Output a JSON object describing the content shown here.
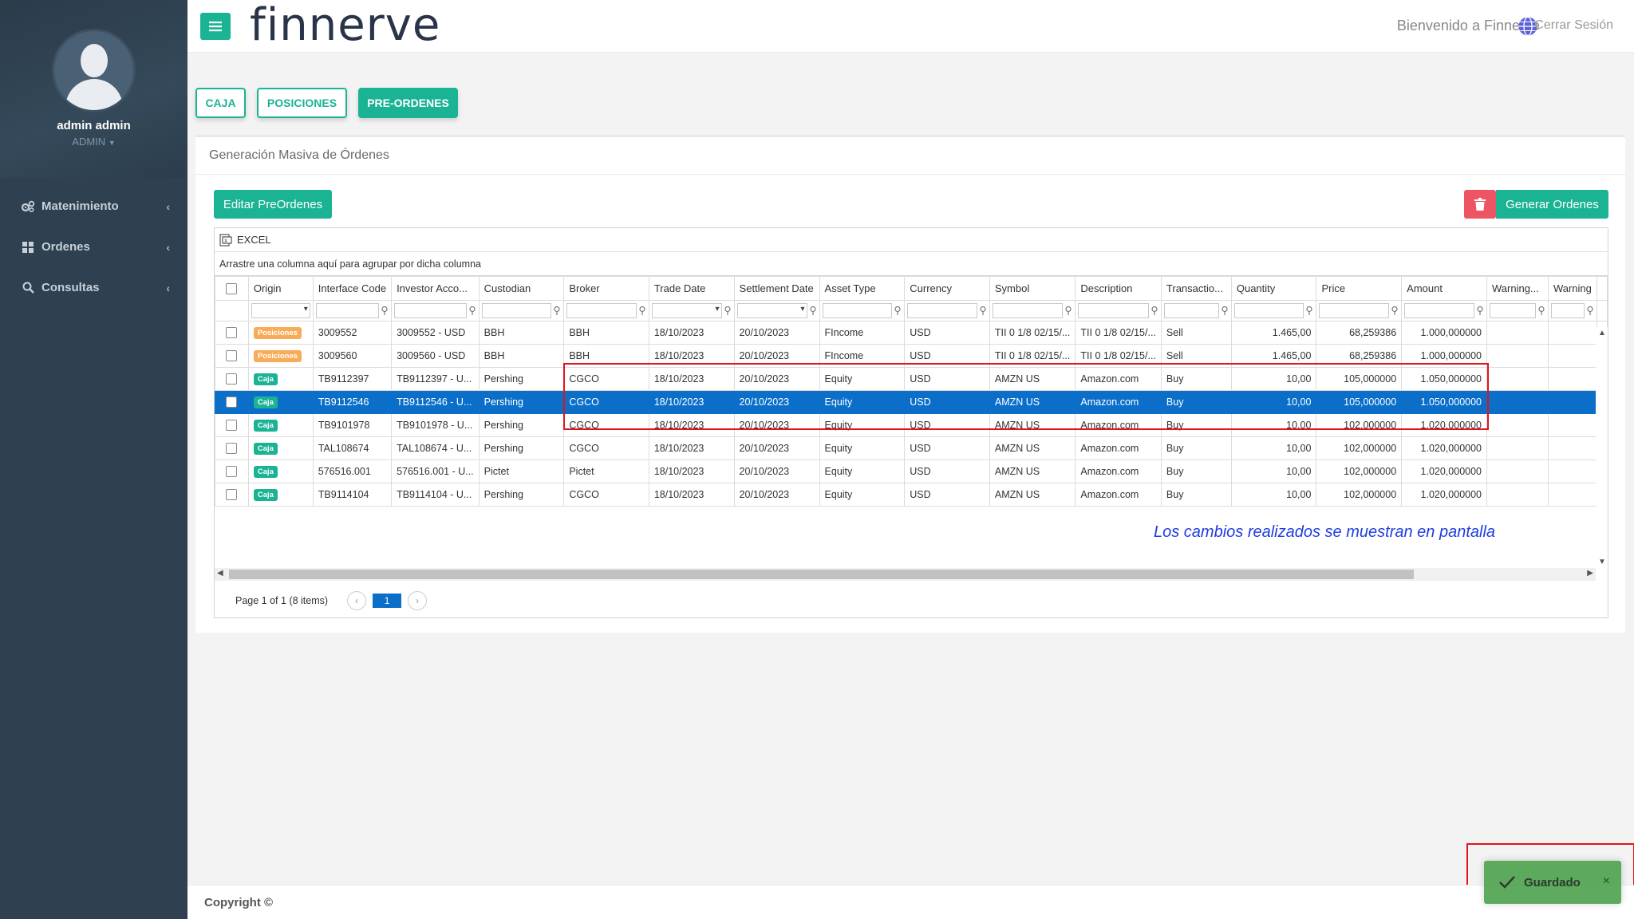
{
  "user": {
    "name": "admin admin",
    "role": "ADMIN"
  },
  "sidebar": {
    "items": [
      {
        "label": "Matenimiento",
        "icon": "gears-icon"
      },
      {
        "label": "Ordenes",
        "icon": "grid-icon"
      },
      {
        "label": "Consultas",
        "icon": "search-icon"
      }
    ]
  },
  "header": {
    "logo": "finnerve",
    "welcome": "Bienvenido a Finnerve",
    "logout": "Cerrar Sesión"
  },
  "tabs": [
    "CAJA",
    "POSICIONES",
    "PRE-ORDENES"
  ],
  "active_tab": "PRE-ORDENES",
  "panel": {
    "title": "Generación Masiva de Órdenes",
    "edit_button": "Editar PreOrdenes",
    "generate_button": "Generar Ordenes"
  },
  "grid": {
    "export_label": "EXCEL",
    "group_hint": "Arrastre una columna aquí para agrupar por dicha columna",
    "columns": [
      "Origin",
      "Interface Code",
      "Investor Acco...",
      "Custodian",
      "Broker",
      "Trade Date",
      "Settlement Date",
      "Asset Type",
      "Currency",
      "Symbol",
      "Description",
      "Transactio...",
      "Quantity",
      "Price",
      "Amount",
      "Warning...",
      "Warning"
    ],
    "rows": [
      {
        "origin": "Posiciones",
        "interface_code": "3009552",
        "investor_account": "3009552 - USD",
        "custodian": "BBH",
        "broker": "BBH",
        "trade_date": "18/10/2023",
        "settlement_date": "20/10/2023",
        "asset_type": "FIncome",
        "currency": "USD",
        "symbol": "TII 0 1/8 02/15/...",
        "description": "TII 0 1/8 02/15/...",
        "transaction": "Sell",
        "quantity": "1.465,00",
        "price": "68,259386",
        "amount": "1.000,000000",
        "selected": false
      },
      {
        "origin": "Posiciones",
        "interface_code": "3009560",
        "investor_account": "3009560 - USD",
        "custodian": "BBH",
        "broker": "BBH",
        "trade_date": "18/10/2023",
        "settlement_date": "20/10/2023",
        "asset_type": "FIncome",
        "currency": "USD",
        "symbol": "TII 0 1/8 02/15/...",
        "description": "TII 0 1/8 02/15/...",
        "transaction": "Sell",
        "quantity": "1.465,00",
        "price": "68,259386",
        "amount": "1.000,000000",
        "selected": false
      },
      {
        "origin": "Caja",
        "interface_code": "TB9112397",
        "investor_account": "TB9112397 - U...",
        "custodian": "Pershing",
        "broker": "CGCO",
        "trade_date": "18/10/2023",
        "settlement_date": "20/10/2023",
        "asset_type": "Equity",
        "currency": "USD",
        "symbol": "AMZN US",
        "description": "Amazon.com",
        "transaction": "Buy",
        "quantity": "10,00",
        "price": "105,000000",
        "amount": "1.050,000000",
        "selected": false
      },
      {
        "origin": "Caja",
        "interface_code": "TB9112546",
        "investor_account": "TB9112546 - U...",
        "custodian": "Pershing",
        "broker": "CGCO",
        "trade_date": "18/10/2023",
        "settlement_date": "20/10/2023",
        "asset_type": "Equity",
        "currency": "USD",
        "symbol": "AMZN US",
        "description": "Amazon.com",
        "transaction": "Buy",
        "quantity": "10,00",
        "price": "105,000000",
        "amount": "1.050,000000",
        "selected": true
      },
      {
        "origin": "Caja",
        "interface_code": "TB9101978",
        "investor_account": "TB9101978 - U...",
        "custodian": "Pershing",
        "broker": "CGCO",
        "trade_date": "18/10/2023",
        "settlement_date": "20/10/2023",
        "asset_type": "Equity",
        "currency": "USD",
        "symbol": "AMZN US",
        "description": "Amazon.com",
        "transaction": "Buy",
        "quantity": "10,00",
        "price": "102,000000",
        "amount": "1.020,000000",
        "selected": false
      },
      {
        "origin": "Caja",
        "interface_code": "TAL108674",
        "investor_account": "TAL108674 - U...",
        "custodian": "Pershing",
        "broker": "CGCO",
        "trade_date": "18/10/2023",
        "settlement_date": "20/10/2023",
        "asset_type": "Equity",
        "currency": "USD",
        "symbol": "AMZN US",
        "description": "Amazon.com",
        "transaction": "Buy",
        "quantity": "10,00",
        "price": "102,000000",
        "amount": "1.020,000000",
        "selected": false
      },
      {
        "origin": "Caja",
        "interface_code": "576516.001",
        "investor_account": "576516.001 - U...",
        "custodian": "Pictet",
        "broker": "Pictet",
        "trade_date": "18/10/2023",
        "settlement_date": "20/10/2023",
        "asset_type": "Equity",
        "currency": "USD",
        "symbol": "AMZN US",
        "description": "Amazon.com",
        "transaction": "Buy",
        "quantity": "10,00",
        "price": "102,000000",
        "amount": "1.020,000000",
        "selected": false
      },
      {
        "origin": "Caja",
        "interface_code": "TB9114104",
        "investor_account": "TB9114104 - U...",
        "custodian": "Pershing",
        "broker": "CGCO",
        "trade_date": "18/10/2023",
        "settlement_date": "20/10/2023",
        "asset_type": "Equity",
        "currency": "USD",
        "symbol": "AMZN US",
        "description": "Amazon.com",
        "transaction": "Buy",
        "quantity": "10,00",
        "price": "102,000000",
        "amount": "1.020,000000",
        "selected": false
      }
    ],
    "pager": {
      "info": "Page 1 of 1 (8 items)",
      "current_page": "1"
    }
  },
  "annotation": "Los cambios realizados se muestran en pantalla",
  "footer": {
    "copyright": "Copyright ©"
  },
  "toast": {
    "message": "Guardado",
    "close": "×"
  },
  "colors": {
    "accent": "#1ab394",
    "sidebar": "#2f4050",
    "selected_row": "#0b6fca",
    "danger": "#ed5565",
    "badge_posiciones": "#f8ac59",
    "highlight": "#e3131b",
    "annotation": "#1f3de0"
  }
}
